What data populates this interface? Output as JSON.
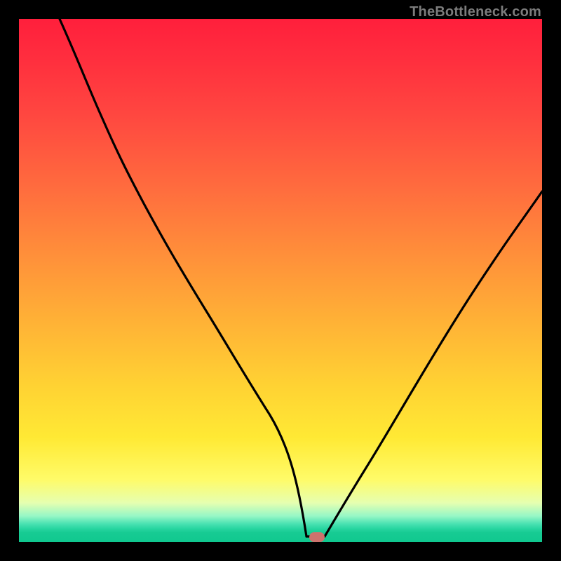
{
  "attribution": "TheBottleneck.com",
  "chart_data": {
    "type": "line",
    "title": "",
    "xlabel": "",
    "ylabel": "",
    "xlim": [
      0,
      100
    ],
    "ylim": [
      0,
      100
    ],
    "grid": false,
    "legend": false,
    "series": [
      {
        "name": "left-curve",
        "x": [
          7.8,
          12,
          16,
          20,
          24,
          28,
          32,
          36,
          40,
          44,
          48,
          51,
          53.5,
          55
        ],
        "values": [
          100,
          90,
          81,
          72.5,
          64.5,
          56.5,
          48.5,
          40.5,
          32.5,
          24,
          15,
          7.5,
          2.5,
          1
        ]
      },
      {
        "name": "flat-segment",
        "x": [
          55,
          58.5
        ],
        "values": [
          1,
          1
        ]
      },
      {
        "name": "right-curve",
        "x": [
          58.5,
          62,
          66,
          70,
          74,
          78,
          82,
          86,
          90,
          94,
          98,
          100
        ],
        "values": [
          1,
          5,
          12,
          19.5,
          27,
          34.5,
          41.5,
          48,
          54,
          59.5,
          64.5,
          67
        ]
      }
    ],
    "marker": {
      "x": 57,
      "y": 1,
      "shape": "rounded-rect",
      "color": "#cd726d"
    },
    "background_gradient": {
      "top": "#ff1f3c",
      "mid": "#ffd233",
      "bottom": "#10c88f"
    },
    "frame_color": "#000000"
  }
}
